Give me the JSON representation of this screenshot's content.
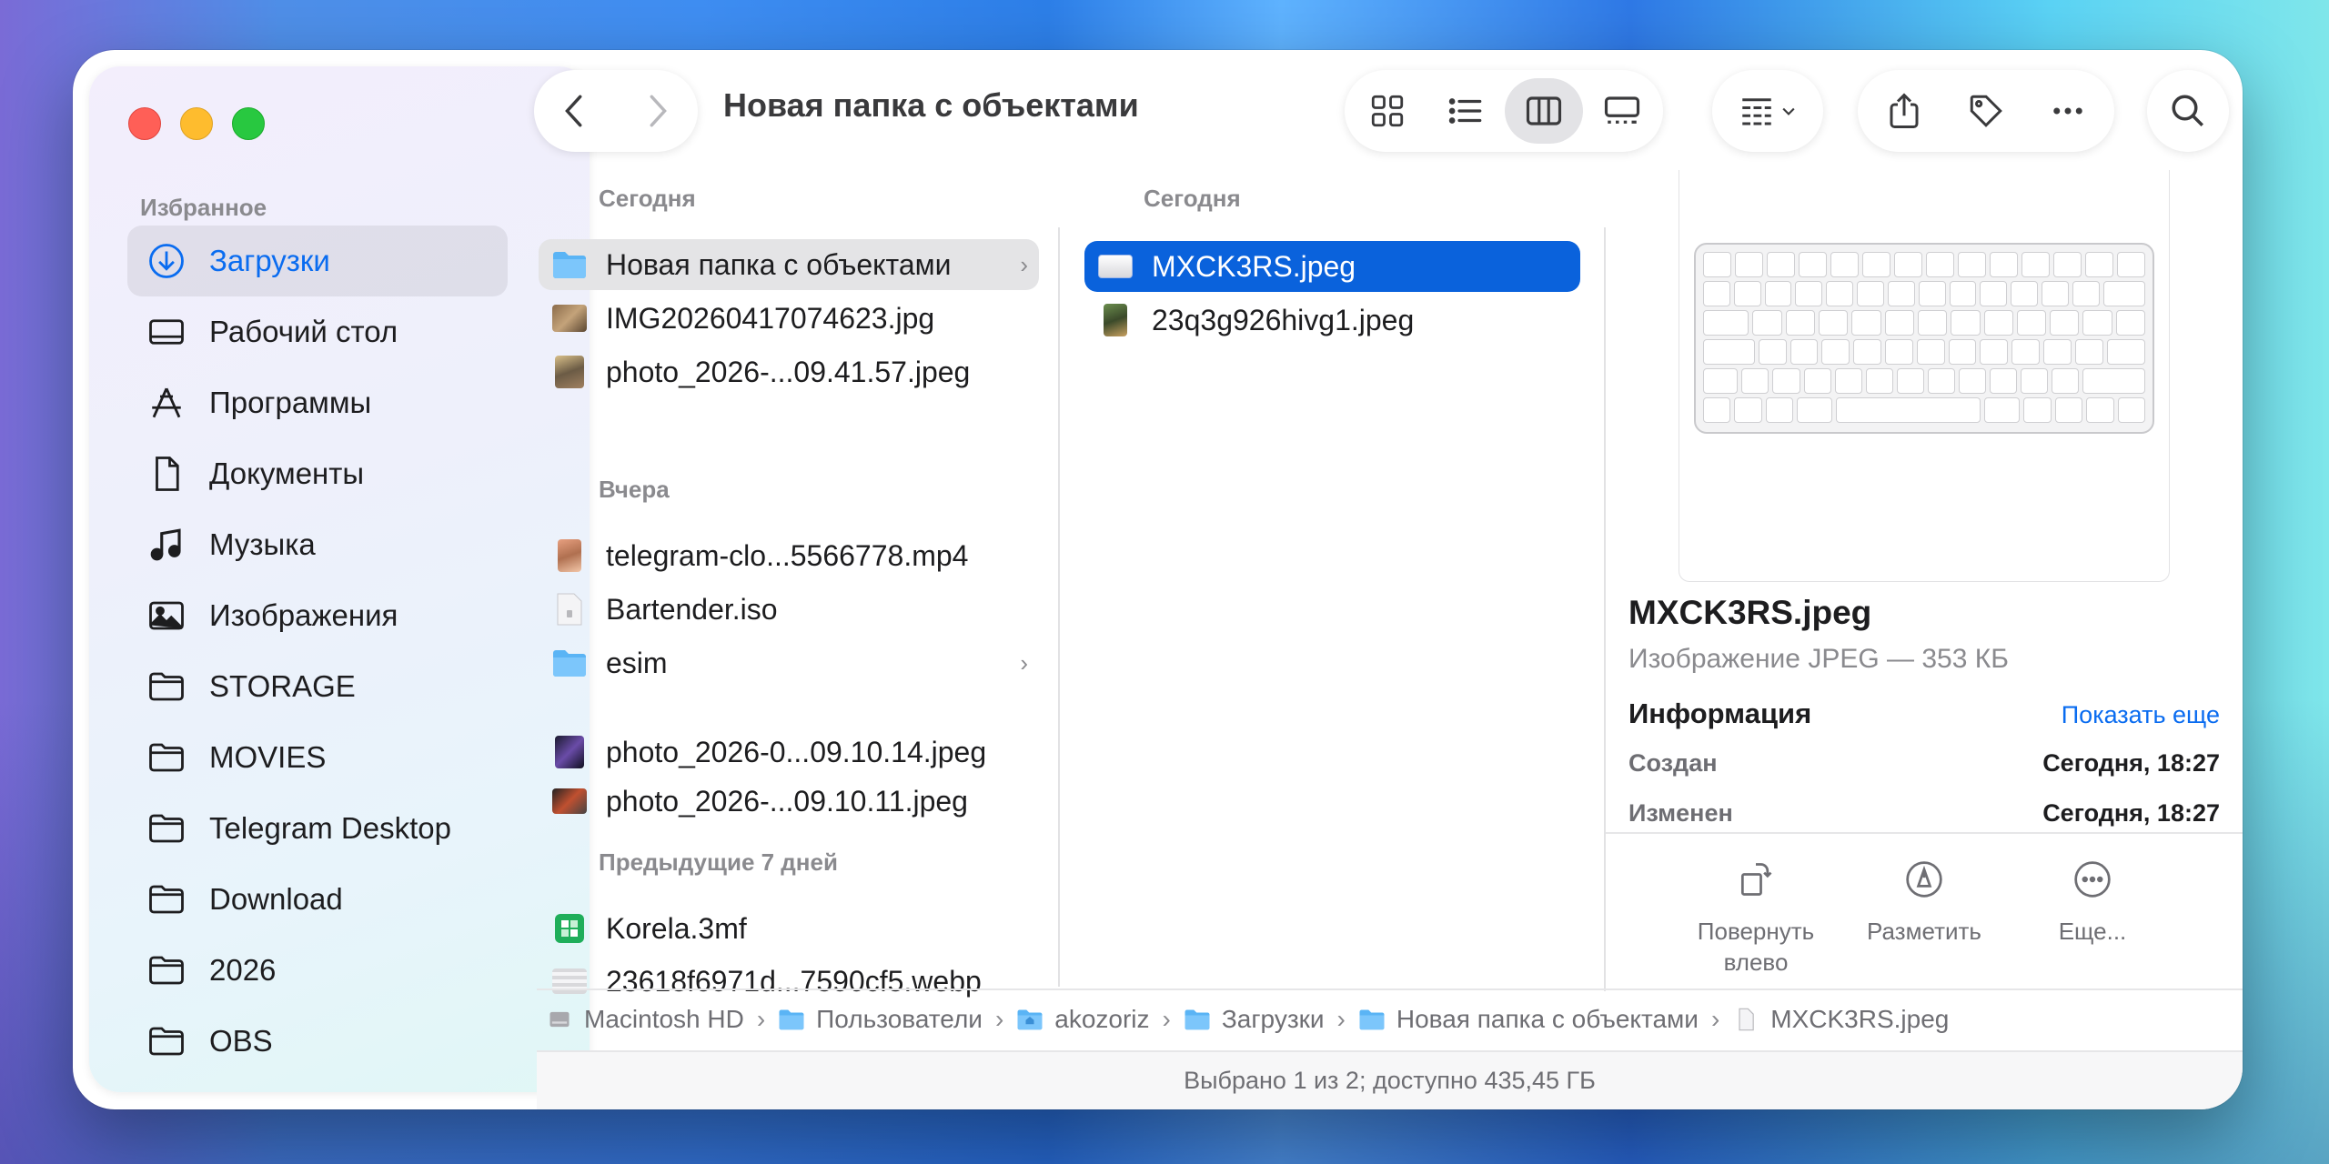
{
  "window": {
    "title": "Новая папка с объектами"
  },
  "sidebar": {
    "section": "Избранное",
    "items": [
      {
        "label": "Загрузки",
        "icon": "download-circle-icon",
        "active": true
      },
      {
        "label": "Рабочий стол",
        "icon": "desktop-icon"
      },
      {
        "label": "Программы",
        "icon": "apps-icon"
      },
      {
        "label": "Документы",
        "icon": "document-icon"
      },
      {
        "label": "Музыка",
        "icon": "music-note-icon"
      },
      {
        "label": "Изображения",
        "icon": "photo-icon"
      },
      {
        "label": "STORAGE",
        "icon": "folder-icon"
      },
      {
        "label": "MOVIES",
        "icon": "folder-icon"
      },
      {
        "label": "Telegram Desktop",
        "icon": "folder-icon"
      },
      {
        "label": "Download",
        "icon": "folder-icon"
      },
      {
        "label": "2026",
        "icon": "folder-icon"
      },
      {
        "label": "OBS",
        "icon": "folder-icon"
      }
    ]
  },
  "column1": {
    "groups": [
      {
        "label": "Сегодня",
        "items": [
          {
            "name": "Новая папка с объектами",
            "kind": "folder",
            "selected": true
          },
          {
            "name": "IMG20260417074623.jpg",
            "kind": "image"
          },
          {
            "name": "photo_2026-...09.41.57.jpeg",
            "kind": "image"
          }
        ]
      },
      {
        "label": "Вчера",
        "items": [
          {
            "name": "telegram-clo...5566778.mp4",
            "kind": "video"
          },
          {
            "name": "Bartender.iso",
            "kind": "disk"
          },
          {
            "name": "esim",
            "kind": "folder"
          },
          {
            "name": "photo_2026-0...09.10.14.jpeg",
            "kind": "image"
          },
          {
            "name": "photo_2026-...09.10.11.jpeg",
            "kind": "image"
          }
        ]
      },
      {
        "label": "Предыдущие 7 дней",
        "items": [
          {
            "name": "Korela.3mf",
            "kind": "3mf"
          },
          {
            "name": "23618f6971d...7590cf5.webp",
            "kind": "image"
          }
        ]
      }
    ]
  },
  "column2": {
    "group_label": "Сегодня",
    "items": [
      {
        "name": "MXCK3RS.jpeg",
        "selected": true
      },
      {
        "name": "23q3g926hivg1.jpeg"
      }
    ]
  },
  "preview": {
    "name": "MXCK3RS.jpeg",
    "kind": "Изображение JPEG — 353 КБ",
    "info_heading": "Информация",
    "show_more": "Показать еще",
    "rows": [
      {
        "key": "Создан",
        "value": "Сегодня, 18:27"
      },
      {
        "key": "Изменен",
        "value": "Сегодня, 18:27"
      }
    ],
    "actions": [
      {
        "label": "Повернуть влево",
        "line1": "Повернуть",
        "line2": "влево"
      },
      {
        "label": "Разметить",
        "line1": "Разметить",
        "line2": ""
      },
      {
        "label": "Еще...",
        "line1": "Еще...",
        "line2": ""
      }
    ]
  },
  "pathbar": [
    "Macintosh HD",
    "Пользователи",
    "akozoriz",
    "Загрузки",
    "Новая папка с объектами",
    "MXCK3RS.jpeg"
  ],
  "status": "Выбрано 1 из 2; доступно 435,45 ГБ",
  "colors": {
    "accent": "#0a62dc",
    "link": "#0a6cf0",
    "folder": "#5ab4f5"
  }
}
